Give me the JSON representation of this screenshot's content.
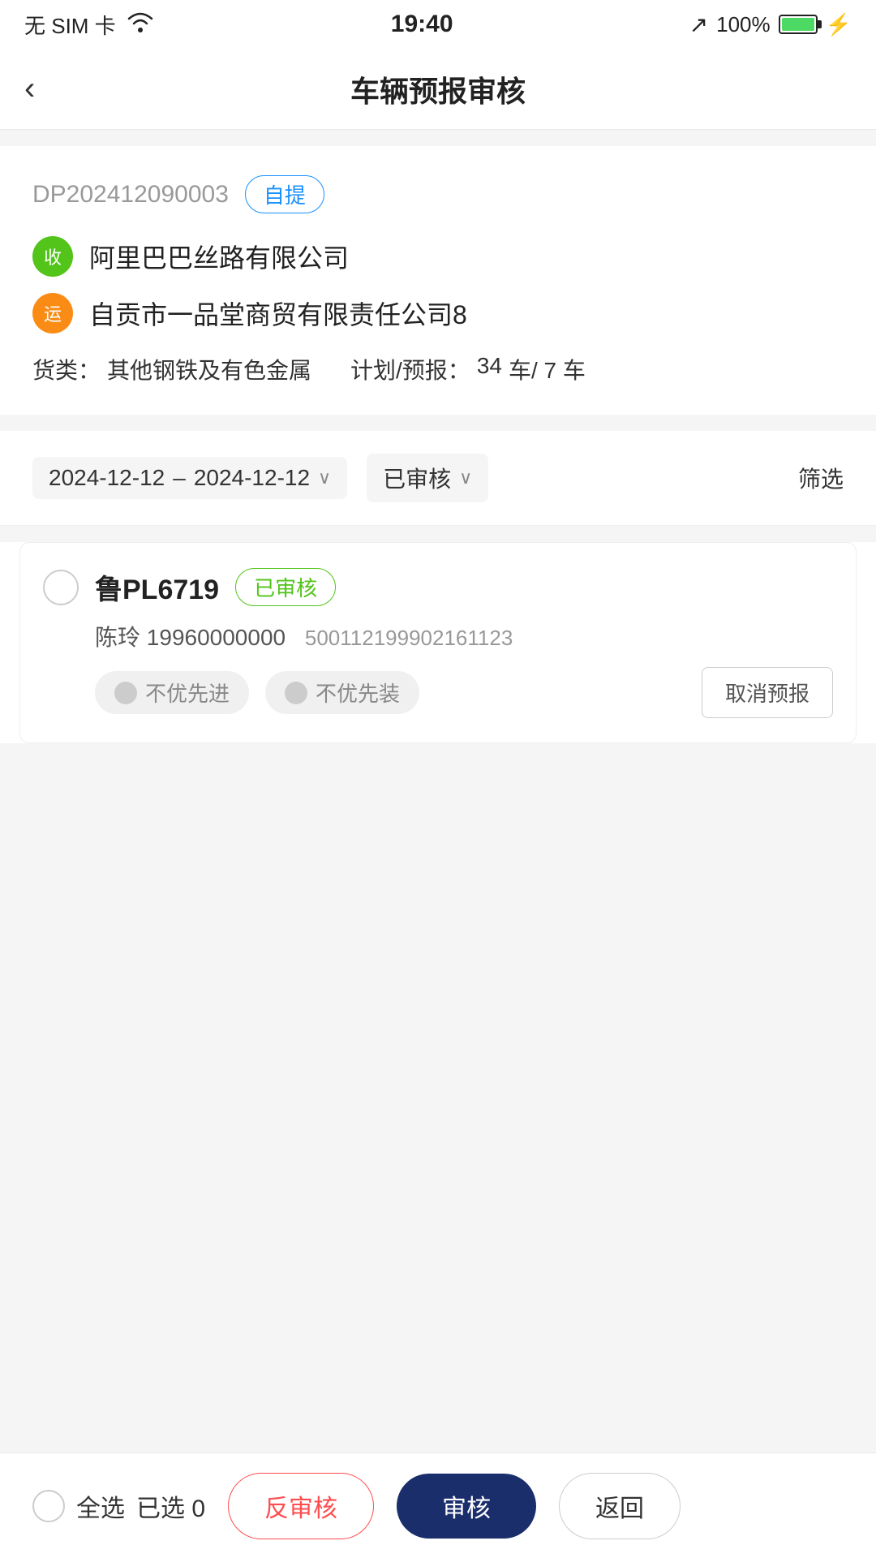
{
  "statusBar": {
    "carrier": "无 SIM 卡",
    "wifi": "WiFi",
    "time": "19:40",
    "gps": "↗",
    "battery_pct": "100%"
  },
  "navBar": {
    "back_label": "‹",
    "title": "车辆预报审核"
  },
  "orderCard": {
    "order_id": "DP202412090003",
    "tag": "自提",
    "receiver_icon": "收",
    "receiver_name": "阿里巴巴丝路有限公司",
    "shipper_icon": "运",
    "shipper_name": "自贡市一品堂商贸有限责任公司8",
    "meta_goods_label": "货类：",
    "meta_goods": "其他钢铁及有色金属",
    "meta_plan_label": "计划/预报：",
    "meta_plan": "34",
    "meta_cars_label": "车/ 7 车"
  },
  "filterBar": {
    "date_start": "2024-12-12",
    "date_sep": "–",
    "date_end": "2024-12-12",
    "status_label": "已审核",
    "filter_label": "筛选"
  },
  "vehicles": [
    {
      "plate": "鲁PL6719",
      "status_badge": "已审核",
      "driver": "陈玲",
      "phone": "19960000000",
      "id_num": "500112199902161123",
      "toggle1": "不优先进",
      "toggle2": "不优先装",
      "cancel_btn": "取消预报"
    }
  ],
  "bottomBar": {
    "select_all_label": "全选",
    "selected_label": "已选",
    "selected_count": "0",
    "reverse_audit_label": "反审核",
    "audit_label": "审核",
    "return_label": "返回"
  }
}
